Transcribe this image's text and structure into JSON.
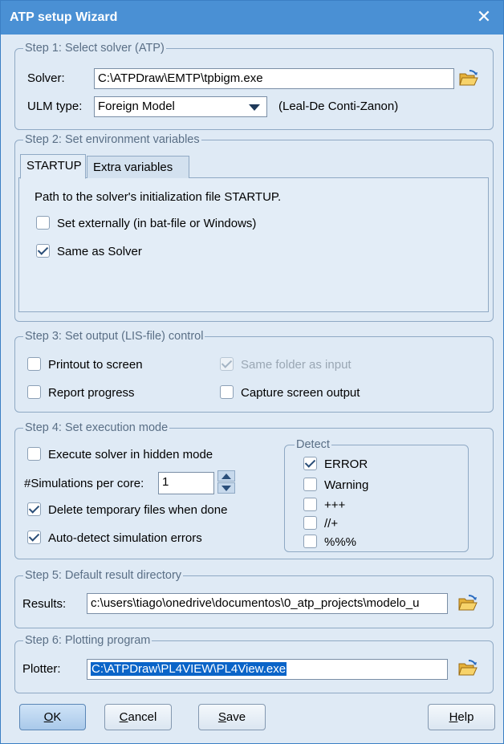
{
  "window": {
    "title": "ATP setup Wizard",
    "close_glyph": "✕"
  },
  "step1": {
    "legend": "Step 1: Select solver (ATP)",
    "solver_label": "Solver:",
    "solver_value": "C:\\ATPDraw\\EMTP\\tpbigm.exe",
    "ulm_label": "ULM type:",
    "ulm_value": "Foreign Model",
    "ulm_note": "(Leal-De Conti-Zanon)"
  },
  "step2": {
    "legend": "Step 2: Set environment variables",
    "tabs": [
      {
        "label": "STARTUP",
        "active": true
      },
      {
        "label": "Extra variables",
        "active": false
      }
    ],
    "description": "Path to the solver's initialization file STARTUP.",
    "options": [
      {
        "label": "Set externally (in bat-file or Windows)",
        "checked": false
      },
      {
        "label": "Same as Solver",
        "checked": true
      }
    ]
  },
  "step3": {
    "legend": "Step 3: Set output (LIS-file) control",
    "printout": {
      "label": "Printout to screen",
      "checked": false
    },
    "same_folder": {
      "label": "Same folder as input",
      "checked": true,
      "disabled": true
    },
    "report": {
      "label": "Report progress",
      "checked": false
    },
    "capture": {
      "label": "Capture screen output",
      "checked": false
    }
  },
  "step4": {
    "legend": "Step 4: Set execution mode",
    "hidden_mode": {
      "label": "Execute solver in hidden mode",
      "checked": false
    },
    "sim_label": "#Simulations per core:",
    "sim_value": "1",
    "delete_temp": {
      "label": "Delete temporary files when done",
      "checked": true
    },
    "auto_detect": {
      "label": "Auto-detect simulation errors",
      "checked": true
    },
    "detect": {
      "legend": "Detect",
      "items": [
        {
          "label": "ERROR",
          "checked": true
        },
        {
          "label": "Warning",
          "checked": false
        },
        {
          "label": "+++",
          "checked": false
        },
        {
          "label": "//+",
          "checked": false
        },
        {
          "label": "%%%",
          "checked": false
        }
      ]
    }
  },
  "step5": {
    "legend": "Step 5: Default result directory",
    "results_label": "Results:",
    "results_value": "c:\\users\\tiago\\onedrive\\documentos\\0_atp_projects\\modelo_u"
  },
  "step6": {
    "legend": "Step 6: Plotting program",
    "plotter_label": "Plotter:",
    "plotter_value": "C:\\ATPDraw\\PL4VIEW\\PL4View.exe"
  },
  "buttons": {
    "ok": {
      "mnemonic": "O",
      "rest": "K"
    },
    "cancel": {
      "mnemonic": "C",
      "rest": "ancel"
    },
    "save": {
      "mnemonic": "S",
      "rest": "ave"
    },
    "help": {
      "mnemonic": "H",
      "rest": "elp"
    }
  },
  "colors": {
    "title_bar": "#4a90d4",
    "dialog_bg": "#dfeaf5",
    "selection": "#0a64c8"
  }
}
